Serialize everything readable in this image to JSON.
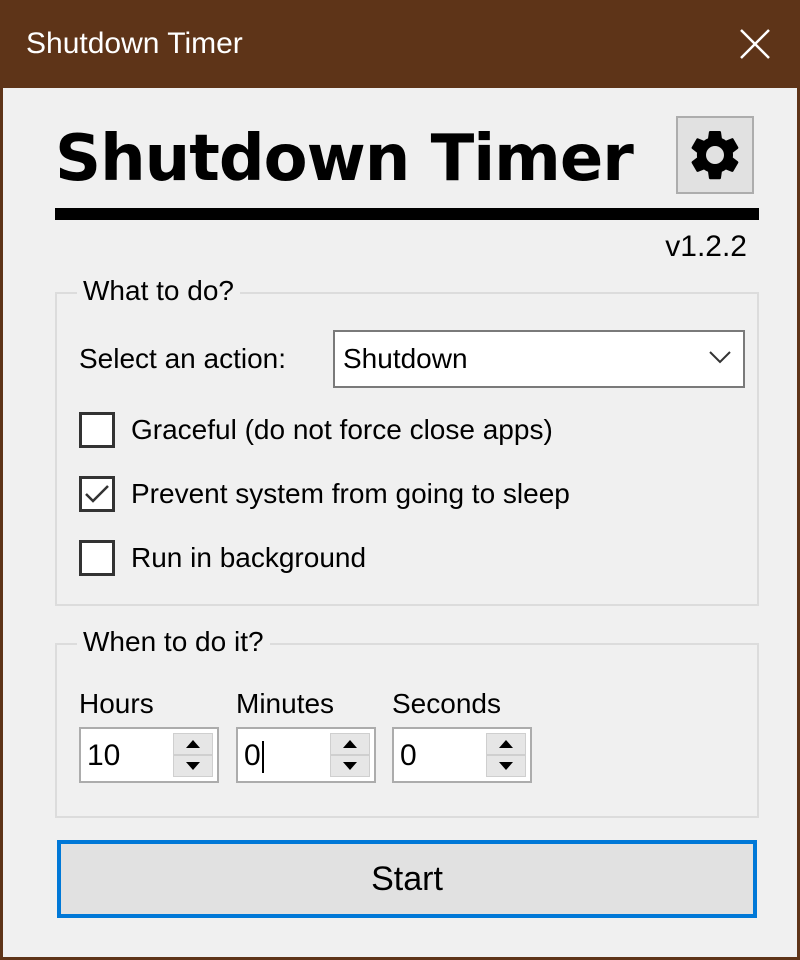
{
  "window": {
    "title": "Shutdown Timer",
    "close_icon": "close-icon",
    "titlebar_color": "#5e3418"
  },
  "header": {
    "app_title": "Shutdown Timer",
    "settings_icon": "gear-icon",
    "version": "v1.2.2"
  },
  "what_group": {
    "legend": "What to do?",
    "action_label": "Select an action:",
    "action_selected": "Shutdown",
    "checkboxes": [
      {
        "label": "Graceful (do not force close apps)",
        "checked": false
      },
      {
        "label": "Prevent system from going to sleep",
        "checked": true
      },
      {
        "label": "Run in background",
        "checked": false
      }
    ]
  },
  "when_group": {
    "legend": "When to do it?",
    "fields": [
      {
        "label": "Hours",
        "value": "10"
      },
      {
        "label": "Minutes",
        "value": "0"
      },
      {
        "label": "Seconds",
        "value": "0"
      }
    ]
  },
  "start_button": {
    "label": "Start",
    "focus_color": "#0078d7"
  }
}
